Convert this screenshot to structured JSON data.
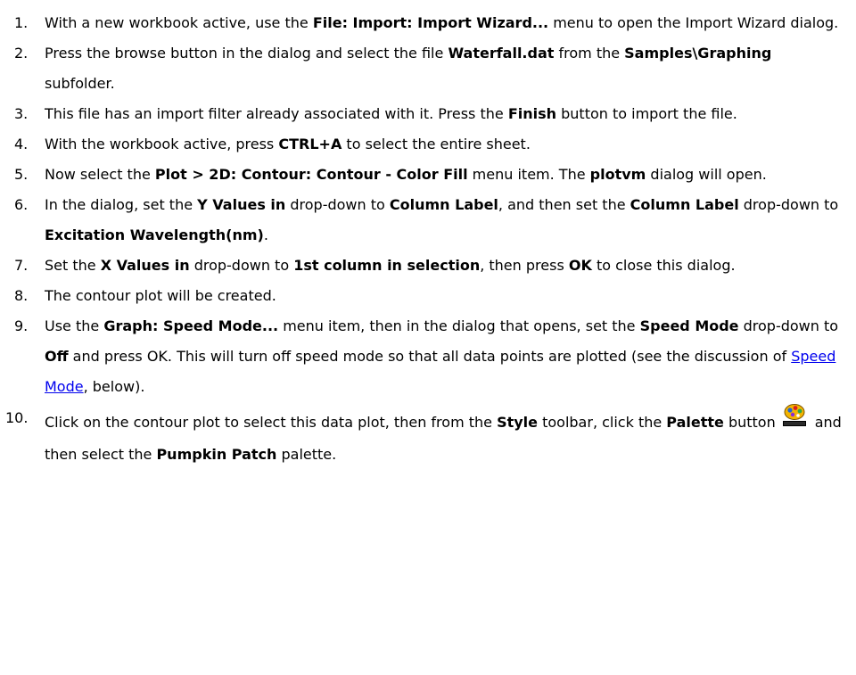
{
  "steps": [
    {
      "num": "1.",
      "parts": [
        {
          "t": "With a new workbook active, use the "
        },
        {
          "b": "File: Import: Import Wizard..."
        },
        {
          "t": " menu to open the Import Wizard dialog."
        }
      ]
    },
    {
      "num": "2.",
      "parts": [
        {
          "t": "Press the browse button in the dialog and select the file "
        },
        {
          "b": "Waterfall.dat"
        },
        {
          "t": " from the "
        },
        {
          "b": "Samples\\Graphing"
        },
        {
          "t": " subfolder."
        }
      ]
    },
    {
      "num": "3.",
      "parts": [
        {
          "t": "This file has an import filter already associated with it. Press the "
        },
        {
          "b": "Finish"
        },
        {
          "t": " button to import the file."
        }
      ]
    },
    {
      "num": "4.",
      "parts": [
        {
          "t": "With the workbook active, press "
        },
        {
          "b": "CTRL+A"
        },
        {
          "t": " to select the entire sheet."
        }
      ]
    },
    {
      "num": "5.",
      "parts": [
        {
          "t": "Now select the "
        },
        {
          "b": "Plot > 2D: Contour: Contour - Color Fill"
        },
        {
          "t": " menu item. The "
        },
        {
          "b": "plotvm"
        },
        {
          "t": " dialog will open."
        }
      ]
    },
    {
      "num": "6.",
      "parts": [
        {
          "t": "In the dialog, set the "
        },
        {
          "b": "Y Values in"
        },
        {
          "t": " drop-down to "
        },
        {
          "b": "Column Label"
        },
        {
          "t": ", and then set the "
        },
        {
          "b": "Column Label"
        },
        {
          "t": " drop-down to "
        },
        {
          "b": "Excitation Wavelength(nm)"
        },
        {
          "t": "."
        }
      ]
    },
    {
      "num": "7.",
      "parts": [
        {
          "t": "Set the "
        },
        {
          "b": "X Values in"
        },
        {
          "t": " drop-down to "
        },
        {
          "b": "1st column in selection"
        },
        {
          "t": ", then press "
        },
        {
          "b": "OK"
        },
        {
          "t": " to close this dialog."
        }
      ]
    },
    {
      "num": "8.",
      "parts": [
        {
          "t": "The contour plot will be created."
        }
      ]
    },
    {
      "num": "9.",
      "parts": [
        {
          "t": "Use the "
        },
        {
          "b": "Graph: Speed Mode..."
        },
        {
          "t": " menu item, then in the dialog that opens, set the "
        },
        {
          "b": "Speed Mode"
        },
        {
          "t": " drop-down to "
        },
        {
          "b": "Off"
        },
        {
          "t": " and press OK. This will turn off speed mode so that all data points are plotted (see the discussion of "
        },
        {
          "link": "Speed Mode"
        },
        {
          "t": ", below)."
        }
      ]
    },
    {
      "num": "10.",
      "parts": [
        {
          "t": "Click on the contour plot to select this data plot, then from the "
        },
        {
          "b": "Style"
        },
        {
          "t": " toolbar, click the "
        },
        {
          "b": "Palette"
        },
        {
          "t": " button"
        },
        {
          "icon": "palette-icon"
        },
        {
          "t": "and then select the "
        },
        {
          "b": "Pumpkin Patch"
        },
        {
          "t": " palette."
        }
      ]
    }
  ]
}
